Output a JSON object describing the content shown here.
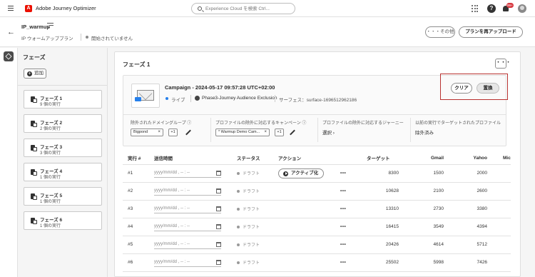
{
  "app": {
    "title": "Adobe Journey Optimizer",
    "logo": "A"
  },
  "search": {
    "placeholder": "Experience Cloud を検索 Ctrl..."
  },
  "notifications": {
    "count": "99+"
  },
  "header": {
    "title": "IP_warmup",
    "type_label": "IP ウォームアッププラン",
    "status": "開始されていません",
    "more_button": "・・・その他",
    "upload_button": "プランを再アップロード"
  },
  "phases_panel": {
    "title": "フェーズ",
    "add_button": "追加",
    "items": [
      {
        "name": "フェーズ 1",
        "runs": "9 個の実行"
      },
      {
        "name": "フェーズ 2",
        "runs": "2 個の実行"
      },
      {
        "name": "フェーズ 3",
        "runs": "3 個の実行"
      },
      {
        "name": "フェーズ 4",
        "runs": "1 個の実行"
      },
      {
        "name": "フェーズ 5",
        "runs": "1 個の実行"
      },
      {
        "name": "フェーズ 6",
        "runs": "1 個の実行"
      }
    ]
  },
  "main": {
    "title": "フェーズ 1",
    "more": "・・・",
    "campaign": {
      "name": "Campaign - 2024-05-17 09:57:28 UTC+02:00",
      "status": "ライブ",
      "journey": "Phase3-Journey Audience Exclusion",
      "surface": "サーフェス：surface-1696512962186",
      "clear_button": "クリア",
      "replace_button": "置換",
      "status_color": "#2680eb"
    },
    "sections": [
      {
        "label": "除外されたドメイングループ ⓘ",
        "tag": "Bigpond",
        "plus": "+1"
      },
      {
        "label": "プロファイルの除外に対応するキャンペーン ⓘ",
        "tag": "* Warmup Demo Cam...",
        "plus": "+1"
      },
      {
        "label": "プロファイルの除外に対応するジャーニー",
        "link": "選択 ›"
      },
      {
        "label": "以前の実行でターゲットされたプロファイル",
        "value": "除外済み"
      }
    ],
    "table": {
      "headers": [
        "実行 #",
        "送信時間",
        "ステータス",
        "アクション",
        "",
        "ターゲット",
        "Gmail",
        "Yahoo",
        "Mic"
      ],
      "rows": [
        {
          "run": "#1",
          "time": "yyyy/mm/dd , -- : --",
          "status": "ドラフト",
          "action": "アクティブ化",
          "more": "•••",
          "target": "8300",
          "gmail": "1500",
          "yahoo": "2000"
        },
        {
          "run": "#2",
          "time": "yyyy/mm/dd , -- : --",
          "status": "ドラフト",
          "action": "",
          "more": "•••",
          "target": "10628",
          "gmail": "2100",
          "yahoo": "2600"
        },
        {
          "run": "#3",
          "time": "yyyy/mm/dd , -- : --",
          "status": "ドラフト",
          "action": "",
          "more": "•••",
          "target": "13310",
          "gmail": "2730",
          "yahoo": "3380"
        },
        {
          "run": "#4",
          "time": "yyyy/mm/dd , -- : --",
          "status": "ドラフト",
          "action": "",
          "more": "•••",
          "target": "16415",
          "gmail": "3549",
          "yahoo": "4394"
        },
        {
          "run": "#5",
          "time": "yyyy/mm/dd , -- : --",
          "status": "ドラフト",
          "action": "",
          "more": "•••",
          "target": "20426",
          "gmail": "4614",
          "yahoo": "5712"
        },
        {
          "run": "#6",
          "time": "yyyy/mm/dd , -- : --",
          "status": "ドラフト",
          "action": "",
          "more": "•••",
          "target": "25502",
          "gmail": "5998",
          "yahoo": "7426"
        }
      ]
    }
  },
  "colors": {
    "brand": "#eb1000",
    "accent": "#2680eb",
    "highlight_border": "#b8312f"
  }
}
